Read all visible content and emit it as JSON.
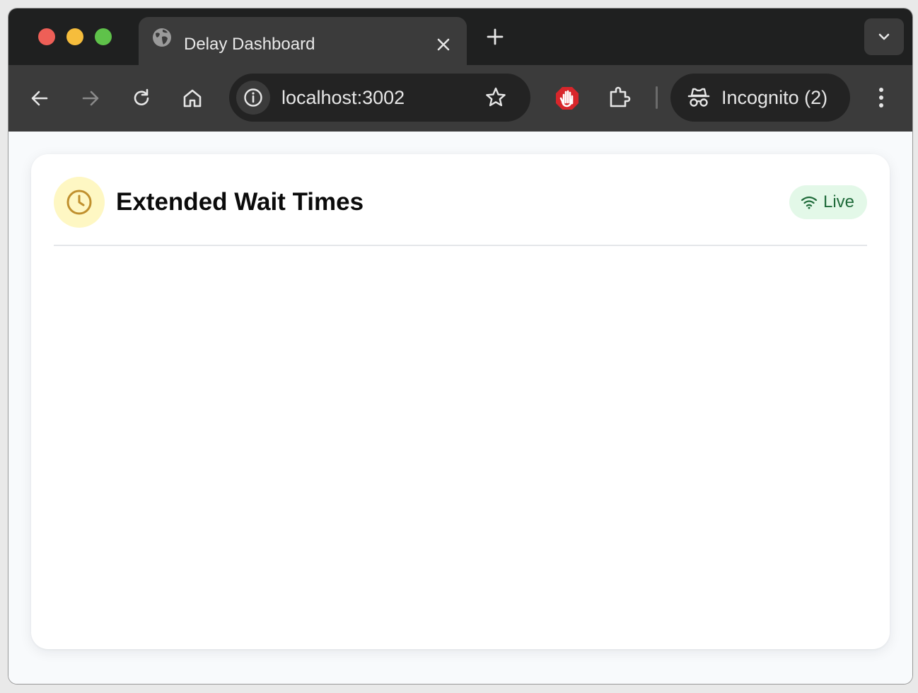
{
  "browser": {
    "tab": {
      "title": "Delay Dashboard",
      "icon": "globe-icon"
    },
    "address_bar": {
      "url": "localhost:3002"
    },
    "profile": {
      "label": "Incognito (2)"
    }
  },
  "card": {
    "title": "Extended Wait Times",
    "icon": "clock-icon",
    "status": {
      "label": "Live",
      "icon": "wifi-icon"
    }
  },
  "colors": {
    "clock_badge_bg": "#fef7c3",
    "clock_icon": "#c0902e",
    "live_pill_bg": "#e3f8e8",
    "live_text": "#1f6b3a"
  }
}
